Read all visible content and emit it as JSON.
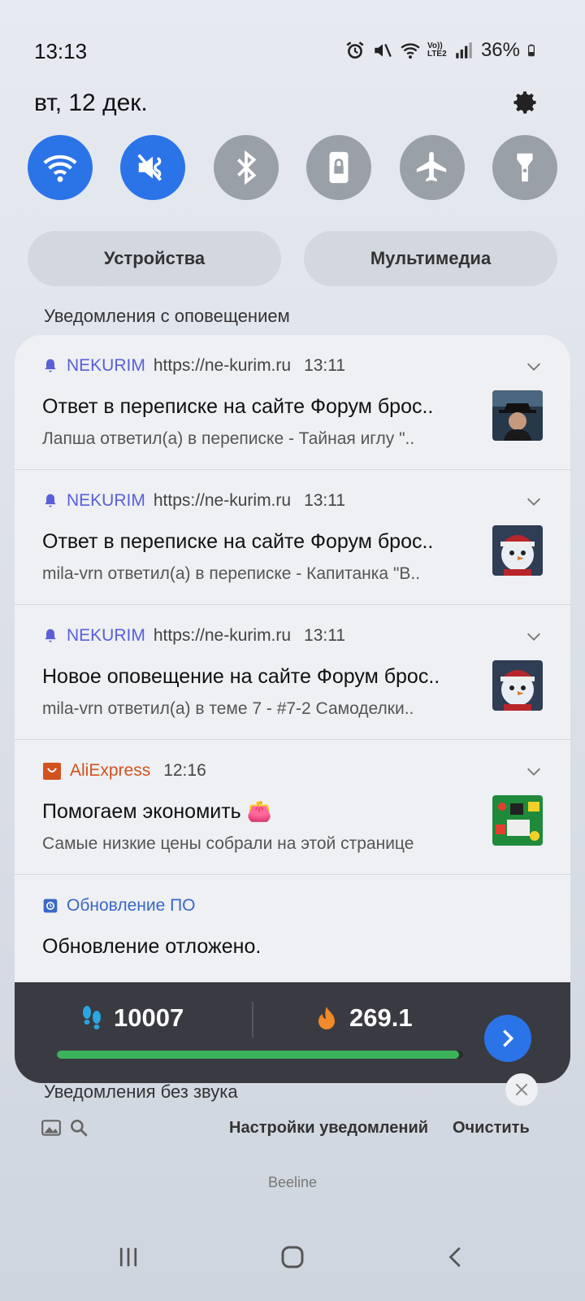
{
  "status": {
    "time": "13:13",
    "volte": "Vo)) LTE2",
    "battery": "36%",
    "icons": [
      "alarm-icon",
      "mute-icon",
      "wifi-icon",
      "volte-icon",
      "signal-icon",
      "battery-icon"
    ]
  },
  "date": "вт, 12 дек.",
  "quick_settings": [
    {
      "name": "wifi",
      "icon": "wifi-icon",
      "on": true
    },
    {
      "name": "mute",
      "icon": "mute-icon",
      "on": true
    },
    {
      "name": "bluetooth",
      "icon": "bluetooth-icon",
      "on": false
    },
    {
      "name": "rotation-lock",
      "icon": "lock-icon",
      "on": false
    },
    {
      "name": "airplane",
      "icon": "airplane-icon",
      "on": false
    },
    {
      "name": "flashlight",
      "icon": "flashlight-icon",
      "on": false
    }
  ],
  "pills": {
    "devices": "Устройства",
    "media": "Мультимедиа"
  },
  "sections": {
    "alerting": "Уведомления с оповещением",
    "silent": "Уведомления без звука"
  },
  "notifications": [
    {
      "app": "NEKURIM",
      "url": "https://ne-kurim.ru",
      "time": "13:11",
      "title": "Ответ в переписке на сайте Форум брос..",
      "body": "Лапша ответил(а) в переписке - Тайная иглу \".."
    },
    {
      "app": "NEKURIM",
      "url": "https://ne-kurim.ru",
      "time": "13:11",
      "title": "Ответ в переписке на сайте Форум брос..",
      "body": "mila-vrn ответил(а) в переписке - Капитанка \"В.."
    },
    {
      "app": "NEKURIM",
      "url": "https://ne-kurim.ru",
      "time": "13:11",
      "title": "Новое оповещение на сайте Форум брос..",
      "body": "mila-vrn ответил(а) в теме 7 - #7-2  Самоделки.."
    },
    {
      "app": "AliExpress",
      "url": "",
      "time": "12:16",
      "title": "Помогаем экономить 👛",
      "body": "Самые низкие цены собрали на этой странице"
    },
    {
      "app": "Обновление ПО",
      "url": "",
      "time": "",
      "title": "Обновление отложено.",
      "body": ""
    }
  ],
  "fitness": {
    "steps": "10007",
    "kcal": "269.1",
    "progress_fraction": 0.99,
    "accent": "#3cb35a"
  },
  "footer": {
    "settings": "Настройки уведомлений",
    "clear": "Очистить",
    "carrier": "Beeline"
  },
  "colors": {
    "accent": "#2b74e8",
    "nekurim": "#5a5fd8",
    "aliexpress": "#d2521f"
  }
}
